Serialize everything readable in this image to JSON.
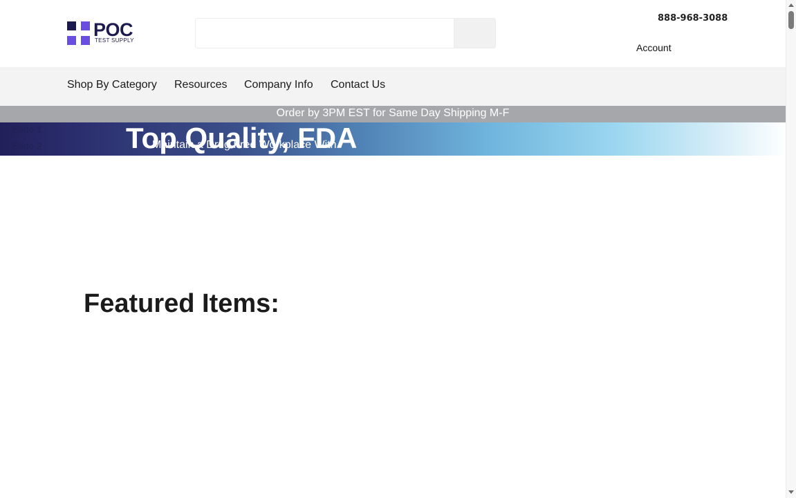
{
  "logo": {
    "brand": "POC",
    "tagline": "TEST SUPPLY"
  },
  "search": {
    "placeholder": "",
    "value": ""
  },
  "header": {
    "phone": "888-968-3088",
    "account_label": "Account"
  },
  "nav": {
    "items": [
      {
        "label": "Shop By Category"
      },
      {
        "label": "Resources"
      },
      {
        "label": "Company Info"
      },
      {
        "label": "Contact Us"
      }
    ]
  },
  "shipping_banner": {
    "text": "Order by 3PM EST for Same Day Shipping M-F"
  },
  "hero": {
    "slides": [
      "Slide 1",
      "Slide 2"
    ],
    "headline": "Top Quality, FDA",
    "subtext": "Maintain a Drug Free Workplace With"
  },
  "featured": {
    "heading": "Featured Items:"
  },
  "colors": {
    "brand_dark": "#1d1b4d",
    "brand_accent": "#6a4ee0",
    "nav_bg": "#f3f3f3",
    "shipbar_bg": "#a5a7aa"
  }
}
